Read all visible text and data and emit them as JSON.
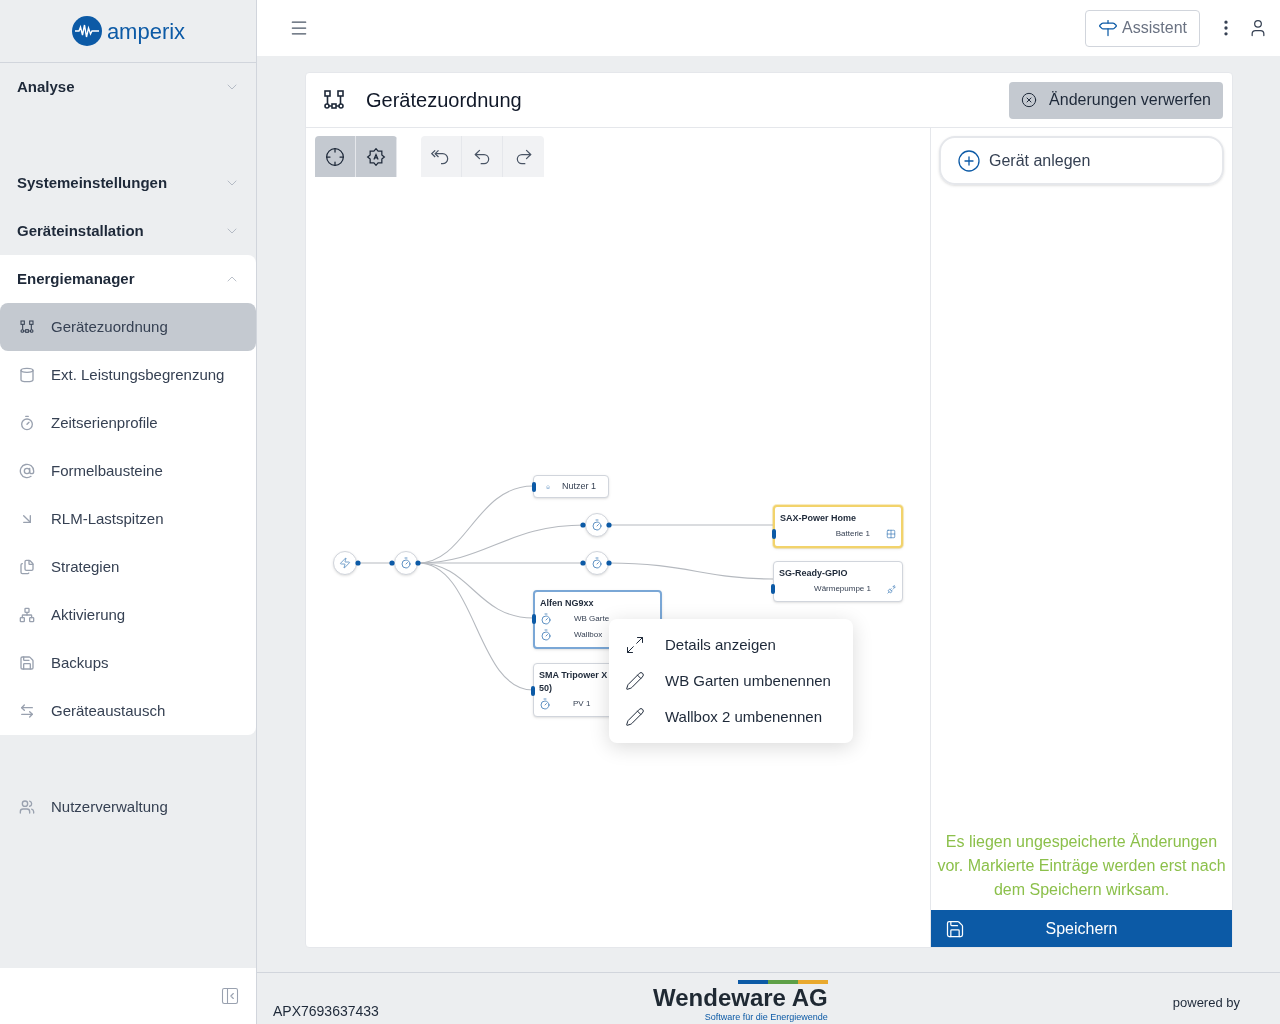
{
  "brand": {
    "name": "amperix"
  },
  "sidebar": {
    "sections": [
      {
        "label": "Analyse",
        "expanded": false
      },
      {
        "label": "Systemeinstellungen",
        "expanded": false
      },
      {
        "label": "Geräteinstallation",
        "expanded": false
      },
      {
        "label": "Energiemanager",
        "expanded": true,
        "items": [
          {
            "label": "Gerätezuordnung",
            "selected": true
          },
          {
            "label": "Ext. Leistungsbegrenzung",
            "selected": false
          },
          {
            "label": "Zeitserienprofile",
            "selected": false
          },
          {
            "label": "Formelbausteine",
            "selected": false
          },
          {
            "label": "RLM-Lastspitzen",
            "selected": false
          },
          {
            "label": "Strategien",
            "selected": false
          },
          {
            "label": "Aktivierung",
            "selected": false
          },
          {
            "label": "Backups",
            "selected": false
          },
          {
            "label": "Geräteaustausch",
            "selected": false
          }
        ]
      }
    ],
    "bottom_items": [
      {
        "label": "Nutzerverwaltung"
      }
    ]
  },
  "header": {
    "assistant_button": "Assistent"
  },
  "page": {
    "title": "Gerätezuordnung",
    "discard_button": "Änderungen verwerfen"
  },
  "toolbar": {
    "view_buttons": [
      {
        "selected": true
      },
      {
        "selected": true
      }
    ]
  },
  "diagram": {
    "nodes": [
      {
        "kind": "consumer",
        "title": "Nutzer 1",
        "modified": false,
        "selected": false
      },
      {
        "kind": "device",
        "title": "SAX-Power Home",
        "modified": true,
        "selected": false,
        "rows": [
          {
            "label": "Batterie 1"
          }
        ]
      },
      {
        "kind": "device",
        "title": "SG-Ready-GPIO",
        "modified": false,
        "selected": false,
        "rows": [
          {
            "label": "Wärmepumpe 1"
          }
        ]
      },
      {
        "kind": "device",
        "title": "Alfen NG9xx",
        "modified": false,
        "selected": true,
        "rows": [
          {
            "label": "WB Garte"
          },
          {
            "label": "Wallbox"
          }
        ]
      },
      {
        "kind": "device",
        "title": "SMA Tripower X\n50)",
        "modified": false,
        "selected": false,
        "rows": [
          {
            "label": "PV 1"
          }
        ]
      }
    ]
  },
  "context_menu": {
    "items": [
      {
        "kind": "details",
        "label": "Details anzeigen"
      },
      {
        "kind": "rename",
        "label": "WB Garten umbenennen"
      },
      {
        "kind": "rename",
        "label": "Wallbox 2 umbenennen"
      }
    ]
  },
  "side_panel": {
    "add_button": "Gerät anlegen",
    "notice": "Es liegen ungespeicherte Änderungen vor. Markierte Einträge werden erst nach dem Speichern wirksam.",
    "save_button": "Speichern"
  },
  "footer": {
    "device_id": "APX7693637433",
    "company": "Wendeware AG",
    "tagline": "Software für die Energiewende",
    "powered_by": "powered by"
  }
}
